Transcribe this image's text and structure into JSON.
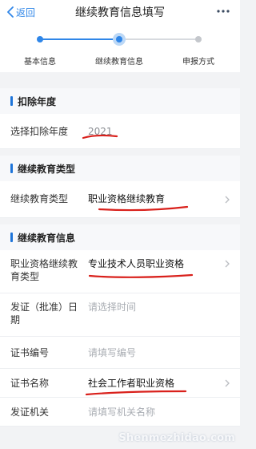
{
  "nav": {
    "back_label": "返回",
    "title": "继续教育信息填写"
  },
  "stepper": {
    "steps": [
      {
        "label": "基本信息",
        "state": "done"
      },
      {
        "label": "继续教育信息",
        "state": "current"
      },
      {
        "label": "申报方式",
        "state": "pending"
      }
    ]
  },
  "sections": {
    "deduction_year": {
      "title": "扣除年度",
      "row_label": "选择扣除年度",
      "value": "2021"
    },
    "edu_type": {
      "title": "继续教育类型",
      "row_label": "继续教育类型",
      "value": "职业资格继续教育"
    },
    "edu_info": {
      "title": "继续教育信息",
      "qual_type_label": "职业资格继续教育类型",
      "qual_type_value": "专业技术人员职业资格",
      "issue_date_label": "发证（批准）日期",
      "issue_date_placeholder": "请选择时间",
      "cert_no_label": "证书编号",
      "cert_no_placeholder": "请填写编号",
      "cert_name_label": "证书名称",
      "cert_name_value": "社会工作者职业资格",
      "issuer_label": "发证机关",
      "issuer_placeholder": "请填写机关名称"
    }
  },
  "watermark": "Shenmezhidao.com",
  "colors": {
    "accent": "#2f86e8",
    "pen_mark": "#d9211c"
  }
}
